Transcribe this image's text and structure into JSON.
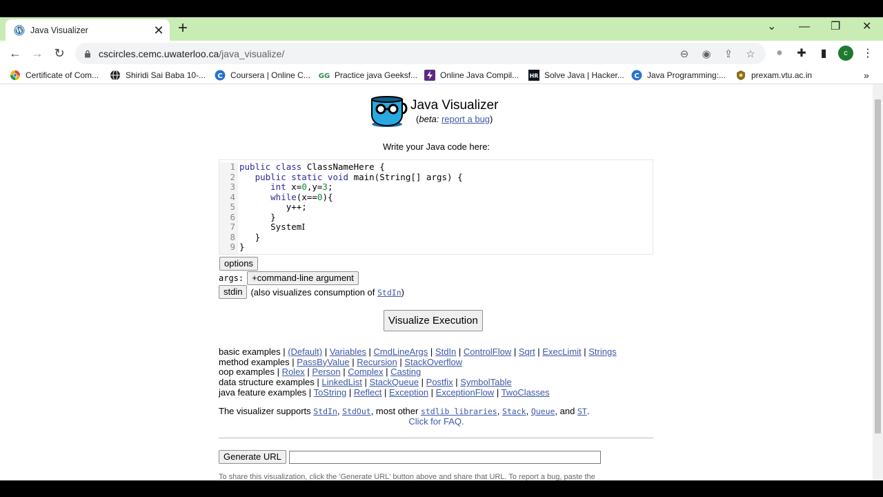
{
  "browser": {
    "tab_title": "Java Visualizer",
    "tab_close": "✕",
    "new_tab": "+",
    "url_host": "cscircles.cemc.uwaterloo.ca",
    "url_path": "/java_visualize/",
    "avatar_letter": "c",
    "bookmarks": [
      {
        "label": "Certificate of Com..."
      },
      {
        "label": "Shiridi Sai Baba 10-..."
      },
      {
        "label": "Coursera | Online C..."
      },
      {
        "label": "Practice java Geeksf..."
      },
      {
        "label": "Online Java Compil..."
      },
      {
        "label": "Solve Java | Hacker..."
      },
      {
        "label": "Java Programming:..."
      },
      {
        "label": "prexam.vtu.ac.in"
      }
    ],
    "more_bookmarks": "»"
  },
  "page": {
    "title": "Java Visualizer",
    "beta_prefix": "beta:",
    "report_bug": "report a bug",
    "prompt": "Write your Java code here:",
    "line_numbers": [
      "1",
      "2",
      "3",
      "4",
      "5",
      "6",
      "7",
      "8",
      "9"
    ],
    "code": {
      "l1_kw": "public class",
      "l1_rest": " ClassNameHere {",
      "l2_kw": "public static void",
      "l2_rest": " main(String[] args) {",
      "l3_kw": "int",
      "l3_a": " x=",
      "l3_n1": "0",
      "l3_b": ",y=",
      "l3_n2": "3",
      "l3_c": ";",
      "l4_kw": "while",
      "l4_a": "(x==",
      "l4_n": "0",
      "l4_b": "){",
      "l5": "y++;",
      "l6": "}",
      "l7": "System",
      "l8": "}",
      "l9": "}"
    },
    "options_button": "options",
    "args_label": "args:",
    "add_arg_button": "+command-line argument",
    "stdin_button": "stdin",
    "stdin_note_prefix": "(also visualizes consumption of ",
    "stdin_note_link": "StdIn",
    "stdin_note_suffix": ")",
    "visualize_button": "Visualize Execution",
    "examples": {
      "basic_label": "basic examples",
      "basic": [
        "(Default)",
        "Variables",
        "CmdLineArgs",
        "StdIn",
        "ControlFlow",
        "Sqrt",
        "ExecLimit",
        "Strings"
      ],
      "method_label": "method examples",
      "method": [
        "PassByValue",
        "Recursion",
        "StackOverflow"
      ],
      "oop_label": "oop examples",
      "oop": [
        "Rolex",
        "Person",
        "Complex",
        "Casting"
      ],
      "ds_label": "data structure examples",
      "ds": [
        "LinkedList",
        "StackQueue",
        "Postfix",
        "SymbolTable"
      ],
      "jf_label": "java feature examples",
      "jf": [
        "ToString",
        "Reflect",
        "Exception",
        "ExceptionFlow",
        "TwoClasses"
      ]
    },
    "supports": {
      "prefix": "The visualizer supports ",
      "stdin": "StdIn",
      "stdout": "StdOut",
      "mid": ", most other ",
      "stdlib": "stdlib libraries",
      "stack": "Stack",
      "queue": "Queue",
      "and": ", and ",
      "st": "ST",
      "end": "."
    },
    "faq": "Click for FAQ.",
    "generate_url_button": "Generate URL",
    "url_field_value": "",
    "share_text": "To share this visualization, click the 'Generate URL' button above and share that URL. To report a bug, paste the"
  }
}
